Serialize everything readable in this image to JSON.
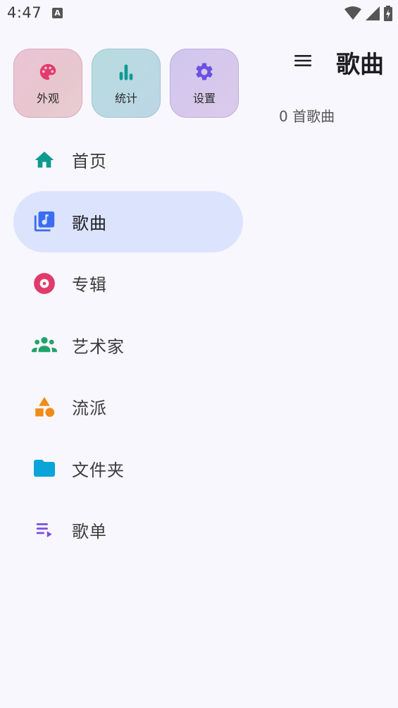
{
  "status_bar": {
    "time": "4:47",
    "notification_letter": "A"
  },
  "quick_tiles": [
    {
      "label": "外观",
      "icon": "palette-icon",
      "color": "#e23b6d"
    },
    {
      "label": "统计",
      "icon": "bar-chart-icon",
      "color": "#0e9a94"
    },
    {
      "label": "设置",
      "icon": "gear-icon",
      "color": "#6b52e0"
    }
  ],
  "nav": {
    "items": [
      {
        "label": "首页",
        "icon": "home-icon",
        "color": "#0b9a8f",
        "selected": false
      },
      {
        "label": "歌曲",
        "icon": "music-library-icon",
        "color": "#3c6df0",
        "selected": true
      },
      {
        "label": "专辑",
        "icon": "album-disc-icon",
        "color": "#e03b6a",
        "selected": false
      },
      {
        "label": "艺术家",
        "icon": "group-icon",
        "color": "#21a36b",
        "selected": false
      },
      {
        "label": "流派",
        "icon": "shapes-icon",
        "color": "#f08c16",
        "selected": false
      },
      {
        "label": "文件夹",
        "icon": "folder-icon",
        "color": "#0aa4d8",
        "selected": false
      },
      {
        "label": "歌单",
        "icon": "playlist-icon",
        "color": "#7c4ee0",
        "selected": false
      }
    ]
  },
  "main": {
    "title": "歌曲",
    "song_count": "0 首歌曲"
  }
}
